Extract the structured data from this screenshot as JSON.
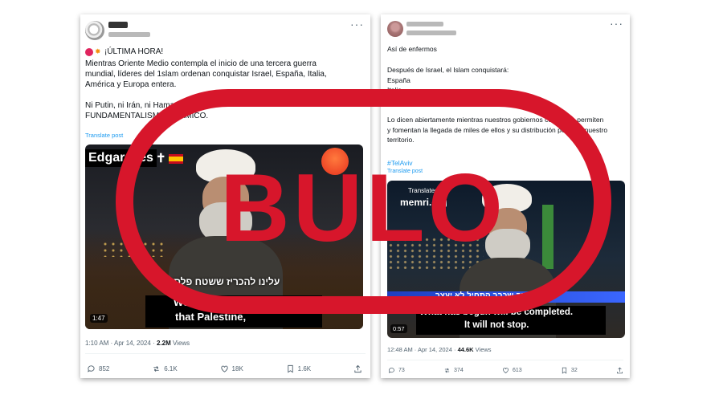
{
  "stamp": {
    "text": "BULO",
    "color": "#d7162b"
  },
  "post1": {
    "headline": "¡ÚLTIMA HORA!",
    "body": "Mientras Oriente Medio contempla el inicio de una tercera guerra\nmundial, líderes del 1slam ordenan conquistar Israel, España, Italia,\nAmérica y Europa entera.\n\nNi Putin, ni Irán, ni Hamas, ni PLO...\nFUNDAMENTALISMO ISLAMICO.",
    "translate": "Translate post",
    "video": {
      "overlay_name": "Edgar__es",
      "hebrew_subtitle": "עלינו להכריז ששטח פלסטין",
      "subtitle_line1": "We must declare",
      "subtitle_line2": "that Palestine,",
      "duration": "1:47"
    },
    "time": "1:10 AM · Apr 14, 2024 · ",
    "views_count": "2.2M",
    "views_label": " Views",
    "replies": "852",
    "reposts": "6.1K",
    "likes": "18K",
    "bookmarks": "1.6K"
  },
  "post2": {
    "line1": "Así de enfermos",
    "body": "Después de Israel, el Islam conquistará:\nEspaña\nItalia\nAmerica",
    "body2": "Lo dicen abiertamente mientras nuestros gobiernos cómplices permiten\ny fomentan la llegada de miles de ellos y su distribución por todo nuestro\nterritorio.",
    "hashtag": "#TelAviv",
    "translate": "Translate post",
    "video": {
      "watermark_top": "Translated by",
      "watermark": "memri.org",
      "hebrew_subtitle": "מה שכבר התחיל לא יעצר",
      "subtitle_line1": "What has begun will be completed.",
      "subtitle_line2": "It will not stop.",
      "duration": "0:57"
    },
    "time": "12:48 AM · Apr 14, 2024 · ",
    "views_count": "44.6K",
    "views_label": " Views",
    "replies": "73",
    "reposts": "374",
    "likes": "613",
    "bookmarks": "32"
  }
}
